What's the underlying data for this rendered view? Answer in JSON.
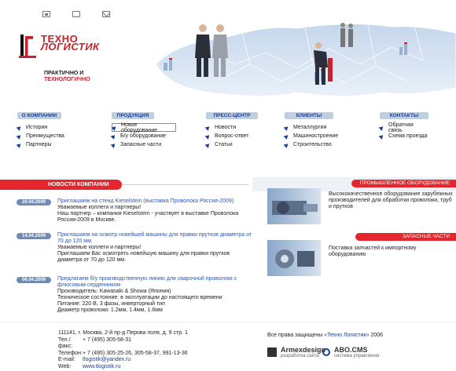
{
  "logo": {
    "line1": "ТЕХНО",
    "line2": "ЛОГИСТИК"
  },
  "slogan": {
    "line1": "ПРАКТИЧНО И",
    "line2": "ТЕХНОЛОГИЧНО"
  },
  "nav": [
    {
      "header": "О КОМПАНИИ",
      "items": [
        "История",
        "Преимущества",
        "Партнеры"
      ]
    },
    {
      "header": "ПРОДУКЦИЯ",
      "items": [
        "Новое оборудование",
        "Б/у оборудование",
        "Запасные части"
      ]
    },
    {
      "header": "ПРЕСС-ЦЕНТР",
      "items": [
        "Новости",
        "Вопрос-ответ",
        "Статьи"
      ]
    },
    {
      "header": "КЛИЕНТЫ",
      "items": [
        "Металлургия",
        "Машиностроение",
        "Строительство"
      ]
    },
    {
      "header": "КОНТАКТЫ",
      "items": [
        "Обратная связь",
        "Схема проезда"
      ]
    }
  ],
  "news": {
    "header": "НОВОСТИ КОМПАНИИ",
    "items": [
      {
        "date": "20.04.2009",
        "title": "Приглашаем на стенд Kieselstein (выставка Проволока Россия-2009)",
        "body": "Уважаемые коллеги и партнеры!\nНаш партнер – компания Kieselstein - участвует в выставке Проволока Россия-2009 в Москве."
      },
      {
        "date": "14.04.2009",
        "title": "Приглашаем на осмотр новейшей машины для правки прутков диаметра от 70 до 120 мм.",
        "body": "Уважаемые коллеги и партнеры!\nПриглашаем Вас осмотреть новейшую машину для правки прутков диаметра от 70 до 120 мм."
      },
      {
        "date": "06.04.2009",
        "title": "Предлагаем б/у производственную линию для сварочной проволоки с флюсовым сердечником",
        "body": "Производитель: Kawasaki & Showa (Япония)\nТехническое состояние: в эксплуатации до настоящего времени\nПитание: 220 В, 3 фазы, инверторный тип\nДиаметр проволоки: 1.2мм, 1.4мм, 1.6мм"
      }
    ]
  },
  "side": {
    "block1": {
      "header": "ПРОМЫШЛЕННОЕ ОБОРУДОВАНИЕ",
      "text": "Высококачественное оборудование зарубежных производителей для обработки проволоки, труб и прутков"
    },
    "block2": {
      "header": "ЗАПАСНЫЕ ЧАСТИ",
      "text": "Поставка запчастей к импортному оборудованию"
    }
  },
  "contacts": {
    "address": "111141, г. Москва, 2-й пр-д Перова поля, д. 9 стр. 1",
    "phone_fax_label": "Тел./факс:",
    "phone_fax": "+ 7 (495) 305-58-31",
    "phone_label": "Телефон:",
    "phone": "+ 7 (495) 305-25-26, 305-58-37, 991-13-36",
    "email_label": "E-mail:",
    "email": "tlogistik@yandex.ru",
    "web_label": "Web:",
    "web": "www.tlogistik.ru"
  },
  "footer": {
    "rights_prefix": "Все права защищены",
    "rights_link": "«Техно Логистик»",
    "rights_year": "2006",
    "partner1_name": "Armexdesign",
    "partner1_sub": "разработка сайта",
    "partner2_name": "ABO.CMS",
    "partner2_sub": "система управления"
  },
  "colors": {
    "brand_red": "#e6262d",
    "nav_blue": "#bfcfe2",
    "link_blue": "#2b57b8"
  }
}
